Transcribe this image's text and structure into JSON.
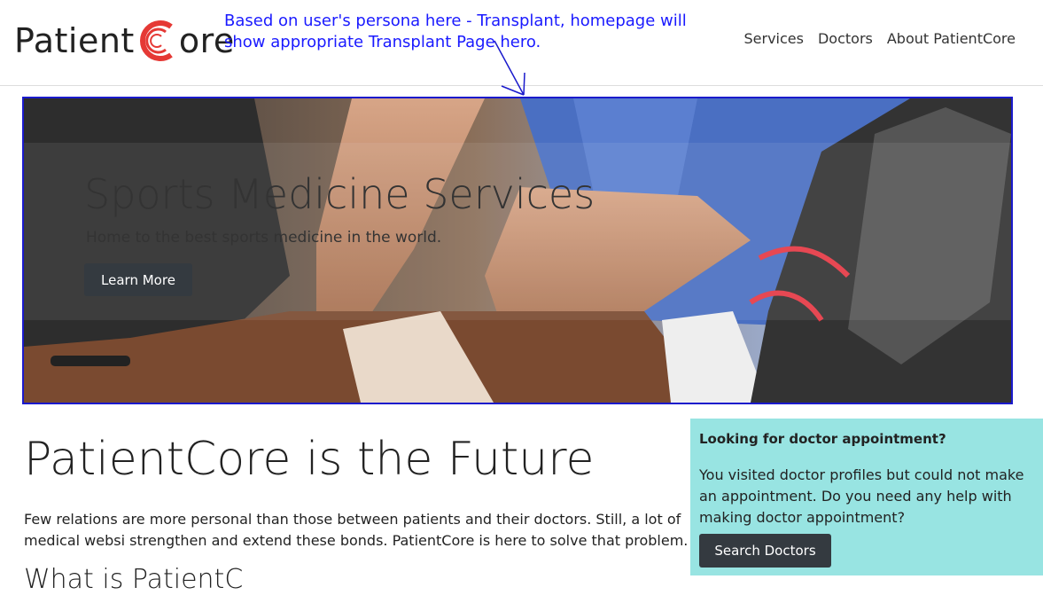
{
  "header": {
    "logo": {
      "part1": "Patient",
      "part2": "ore"
    },
    "annotation": "Based on user's persona here - Transplant, homepage will show appropriate Transplant Page hero.",
    "nav": [
      "Services",
      "Doctors",
      "About PatientCore"
    ]
  },
  "hero": {
    "title": "Sports Medicine Services",
    "subtitle": "Home to the best sports medicine in the world.",
    "button_label": "Learn More"
  },
  "main": {
    "title": "PatientCore is the Future",
    "text": "Few relations are more personal than those between patients and their doctors. Still, a lot of medical websi strengthen and extend these bonds. PatientCore is here to solve that problem.",
    "sub_heading": "What is PatientC"
  },
  "popup": {
    "title": "Looking for doctor appointment?",
    "text": "You visited doctor profiles but could not make an appointment. Do you need any help with making doctor appointment?",
    "button_label": "Search Doctors"
  },
  "colors": {
    "annotation": "#1a1aff",
    "logo_accent": "#e53935",
    "button": "#343a40",
    "popup_bg": "#98e4e2"
  }
}
